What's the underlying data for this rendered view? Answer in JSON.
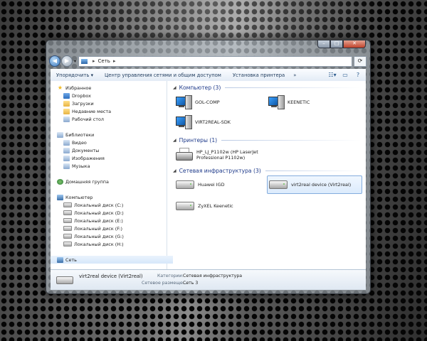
{
  "window": {
    "buttons": {
      "minimize": "–",
      "maximize": "□",
      "close": "✕"
    }
  },
  "address": {
    "path": [
      "Сеть"
    ]
  },
  "toolbar": {
    "organize": "Упорядочить ▾",
    "network_center": "Центр управления сетями и общим доступом",
    "add_printer": "Установка принтера",
    "more": "»"
  },
  "sidebar": {
    "favorites": {
      "title": "Избранное",
      "items": [
        "Dropbox",
        "Загрузки",
        "Недавние места",
        "Рабочий стол"
      ]
    },
    "libraries": {
      "title": "Библиотеки",
      "items": [
        "Видео",
        "Документы",
        "Изображения",
        "Музыка"
      ]
    },
    "homegroup": "Домашняя группа",
    "computer": {
      "title": "Компьютер",
      "drives": [
        "Локальный диск (C:)",
        "Локальный диск (D:)",
        "Локальный диск (E:)",
        "Локальный диск (F:)",
        "Локальный диск (G:)",
        "Локальный диск (H:)"
      ]
    },
    "network": "Сеть"
  },
  "groups": {
    "computers": {
      "title": "Компьютер (3)",
      "items": [
        "GOL-COMP",
        "KEENETIC",
        "VIRT2REAL-SDK"
      ]
    },
    "printers": {
      "title": "Принтеры (1)",
      "items": [
        {
          "line1": "HP_LJ_P1102w (HP LaserJet",
          "line2": "Professional P1102w)"
        }
      ]
    },
    "infrastructure": {
      "title": "Сетевая инфраструктура (3)",
      "items": [
        "Huawei IGD",
        "virt2real device (Virt2real)",
        "ZyXEL Keenetic"
      ]
    }
  },
  "details": {
    "name": "virt2real device (Virt2real)",
    "category_label": "Категории:",
    "category_value": "Сетевая инфраструктура",
    "location_label": "Сетевое размеще...",
    "location_value": "Сеть 3"
  }
}
